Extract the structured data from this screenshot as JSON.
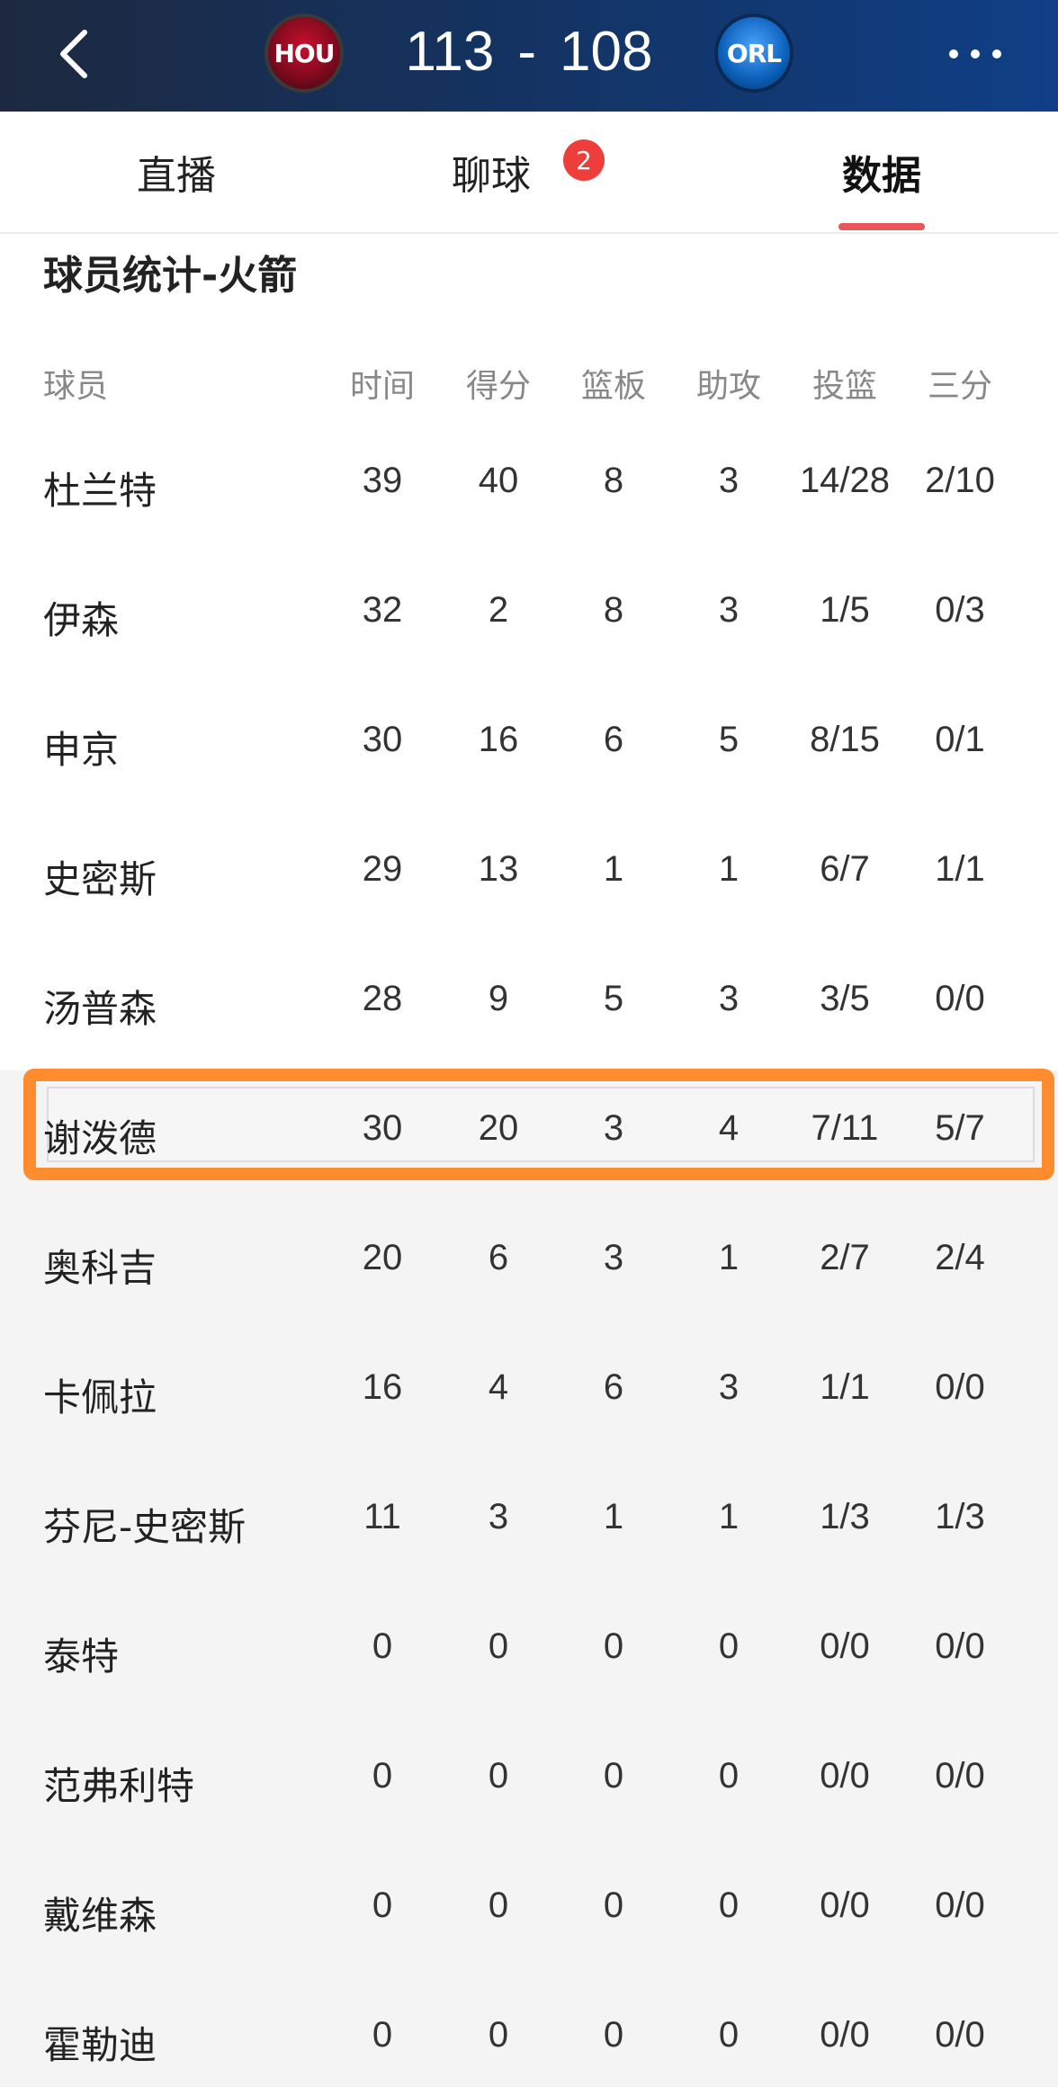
{
  "header": {
    "back_icon": "chevron-left-icon",
    "home_team": "HOU",
    "away_team": "ORL",
    "home_score": "113",
    "separator": "-",
    "away_score": "108",
    "more_icon": "more-dots-icon",
    "colors": {
      "home": "#c8102e",
      "away": "#0b5fb8",
      "bar": "#14325f"
    }
  },
  "tabs": [
    {
      "label": "直播"
    },
    {
      "label": "聊球",
      "badge": "2"
    },
    {
      "label": "数据",
      "active": true
    }
  ],
  "stats": {
    "title": "球员统计-火箭",
    "columns": [
      "球员",
      "时间",
      "得分",
      "篮板",
      "助攻",
      "投篮",
      "三分"
    ],
    "rows": [
      {
        "name": "杜兰特",
        "time": "39",
        "pts": "40",
        "reb": "8",
        "ast": "3",
        "fg": "14/28",
        "tp": "2/10"
      },
      {
        "name": "伊森",
        "time": "32",
        "pts": "2",
        "reb": "8",
        "ast": "3",
        "fg": "1/5",
        "tp": "0/3"
      },
      {
        "name": "申京",
        "time": "30",
        "pts": "16",
        "reb": "6",
        "ast": "5",
        "fg": "8/15",
        "tp": "0/1"
      },
      {
        "name": "史密斯",
        "time": "29",
        "pts": "13",
        "reb": "1",
        "ast": "1",
        "fg": "6/7",
        "tp": "1/1"
      },
      {
        "name": "汤普森",
        "time": "28",
        "pts": "9",
        "reb": "5",
        "ast": "3",
        "fg": "3/5",
        "tp": "0/0"
      },
      {
        "name": "谢泼德",
        "time": "30",
        "pts": "20",
        "reb": "3",
        "ast": "4",
        "fg": "7/11",
        "tp": "5/7",
        "highlighted": true
      },
      {
        "name": "奥科吉",
        "time": "20",
        "pts": "6",
        "reb": "3",
        "ast": "1",
        "fg": "2/7",
        "tp": "2/4"
      },
      {
        "name": "卡佩拉",
        "time": "16",
        "pts": "4",
        "reb": "6",
        "ast": "3",
        "fg": "1/1",
        "tp": "0/0"
      },
      {
        "name": "芬尼-史密斯",
        "time": "11",
        "pts": "3",
        "reb": "1",
        "ast": "1",
        "fg": "1/3",
        "tp": "1/3"
      },
      {
        "name": "泰特",
        "time": "0",
        "pts": "0",
        "reb": "0",
        "ast": "0",
        "fg": "0/0",
        "tp": "0/0"
      },
      {
        "name": "范弗利特",
        "time": "0",
        "pts": "0",
        "reb": "0",
        "ast": "0",
        "fg": "0/0",
        "tp": "0/0"
      },
      {
        "name": "戴维森",
        "time": "0",
        "pts": "0",
        "reb": "0",
        "ast": "0",
        "fg": "0/0",
        "tp": "0/0"
      },
      {
        "name": "霍勒迪",
        "time": "0",
        "pts": "0",
        "reb": "0",
        "ast": "0",
        "fg": "0/0",
        "tp": "0/0"
      }
    ],
    "highlight_color": "#ff8c2e"
  }
}
